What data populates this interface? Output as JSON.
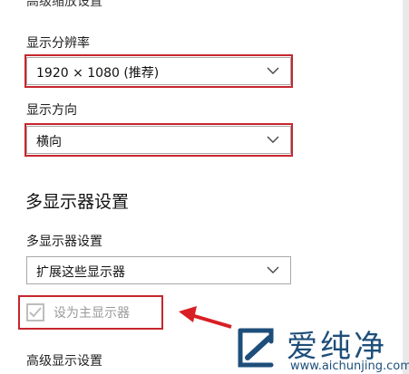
{
  "scale_section": {
    "cut_title": "高级缩放设置"
  },
  "resolution": {
    "label": "显示分辨率",
    "value": "1920 × 1080 (推荐)"
  },
  "orientation": {
    "label": "显示方向",
    "value": "横向"
  },
  "multi_display": {
    "section_title": "多显示器设置",
    "label": "多显示器设置",
    "value": "扩展这些显示器",
    "primary_checkbox": {
      "label": "设为主显示器",
      "checked": true,
      "disabled": true
    }
  },
  "advanced_display_link": "高级显示设置",
  "annotation": {
    "highlight_color": "#c6262e",
    "arrow_color": "#d81f26"
  },
  "watermark": {
    "title": "爱纯净",
    "url": "www.aichunjing.com",
    "color": "#1d4e7a"
  },
  "icons": [
    "chevron-down-icon",
    "checkmark-icon",
    "arrow-annotation",
    "watermark-logo-icon"
  ]
}
